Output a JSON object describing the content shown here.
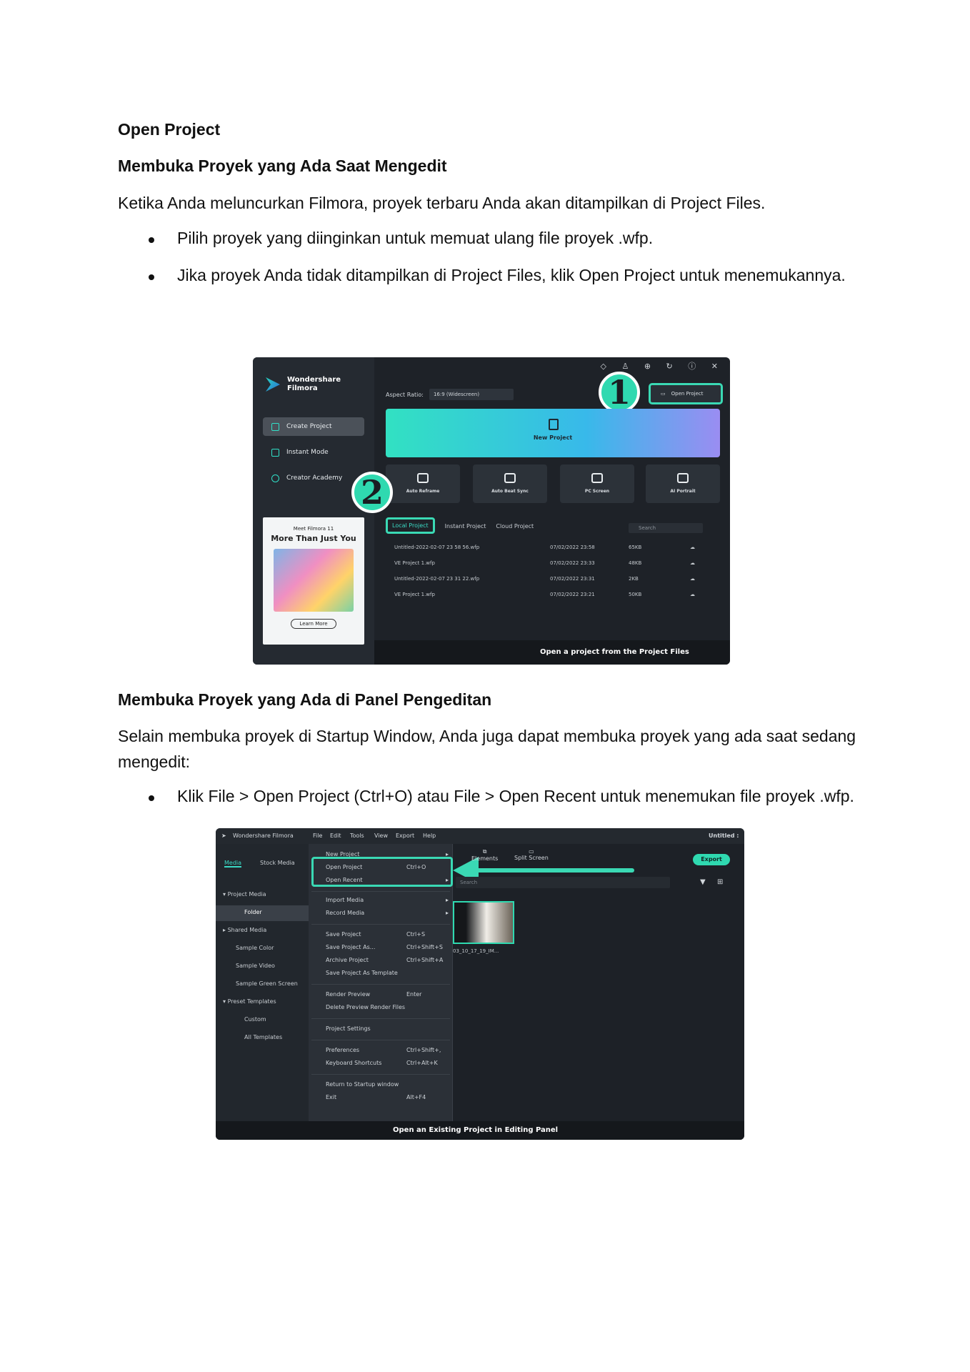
{
  "doc": {
    "heading1": "Open Project",
    "heading2": "Membuka Proyek yang Ada Saat Mengedit",
    "para1": "Ketika Anda meluncurkan Filmora, proyek terbaru Anda akan ditampilkan di Project Files.",
    "bullets1": [
      "Pilih proyek yang diinginkan untuk memuat ulang file proyek .wfp.",
      "Jika proyek Anda tidak ditampilkan di Project Files, klik Open Project untuk menemukannya."
    ],
    "heading3": "Membuka Proyek yang Ada di Panel Pengeditan",
    "para2": "Selain membuka proyek di Startup Window, Anda juga dapat membuka proyek yang ada saat sedang mengedit:",
    "bullets2": [
      "Klik File > Open Project (Ctrl+O) atau File > Open Recent untuk menemukan file proyek .wfp."
    ]
  },
  "shot1": {
    "brand1": "Wondershare",
    "brand2": "Filmora",
    "nav": [
      "Create Project",
      "Instant Mode",
      "Creator Academy"
    ],
    "ad_small": "Meet Filmora 11",
    "ad_title": "More Than Just You",
    "ad_button": "Learn More",
    "aspect_label": "Aspect Ratio:",
    "aspect_value": "16:9 (Widescreen)",
    "open_project": "Open Project",
    "num1": "1",
    "num2": "2",
    "new_project": "New Project",
    "tools": [
      "Auto Reframe",
      "Auto Beat Sync",
      "PC Screen",
      "AI Portrait"
    ],
    "tabs": [
      "Local Project",
      "Instant Project",
      "Cloud Project"
    ],
    "search": "Search",
    "rows": [
      {
        "name": "Untitled-2022-02-07 23 58 56.wfp",
        "date": "07/02/2022 23:58",
        "size": "65KB"
      },
      {
        "name": "VE Project 1.wfp",
        "date": "07/02/2022 23:33",
        "size": "48KB"
      },
      {
        "name": "Untitled-2022-02-07 23 31 22.wfp",
        "date": "07/02/2022 23:31",
        "size": "2KB"
      },
      {
        "name": "VE Project 1.wfp",
        "date": "07/02/2022 23:21",
        "size": "50KB"
      }
    ],
    "caption": "Open a project from the Project Files"
  },
  "shot2": {
    "app": "Wondershare Filmora",
    "menubar": [
      "File",
      "Edit",
      "Tools",
      "View",
      "Export",
      "Help"
    ],
    "untitled": "Untitled :",
    "left_tabs": [
      "Media",
      "Stock Media"
    ],
    "tree": [
      "Project Media",
      "Folder",
      "Shared Media",
      "Sample Color",
      "Sample Video",
      "Sample Green Screen",
      "Preset Templates",
      "Custom",
      "All Templates"
    ],
    "menu": [
      {
        "label": "New Project",
        "shortcut": ""
      },
      {
        "label": "Open Project",
        "shortcut": "Ctrl+O"
      },
      {
        "label": "Open Recent",
        "shortcut": ""
      },
      {
        "label": "Import Media",
        "shortcut": ""
      },
      {
        "label": "Record Media",
        "shortcut": ""
      },
      {
        "label": "Save Project",
        "shortcut": "Ctrl+S"
      },
      {
        "label": "Save Project As...",
        "shortcut": "Ctrl+Shift+S"
      },
      {
        "label": "Archive Project",
        "shortcut": "Ctrl+Shift+A"
      },
      {
        "label": "Save Project As Template",
        "shortcut": ""
      },
      {
        "label": "Render Preview",
        "shortcut": "Enter"
      },
      {
        "label": "Delete Preview Render Files",
        "shortcut": ""
      },
      {
        "label": "Project Settings",
        "shortcut": ""
      },
      {
        "label": "Preferences",
        "shortcut": "Ctrl+Shift+,"
      },
      {
        "label": "Keyboard Shortcuts",
        "shortcut": "Ctrl+Alt+K"
      },
      {
        "label": "Return to Startup window",
        "shortcut": ""
      },
      {
        "label": "Exit",
        "shortcut": "Alt+F4"
      }
    ],
    "top_tabs": [
      "Elements",
      "Split Screen"
    ],
    "search": "Search",
    "export": "Export",
    "thumb_caption": "03_10_17_19_IM...",
    "caption": "Open an Existing Project in Editing Panel"
  }
}
